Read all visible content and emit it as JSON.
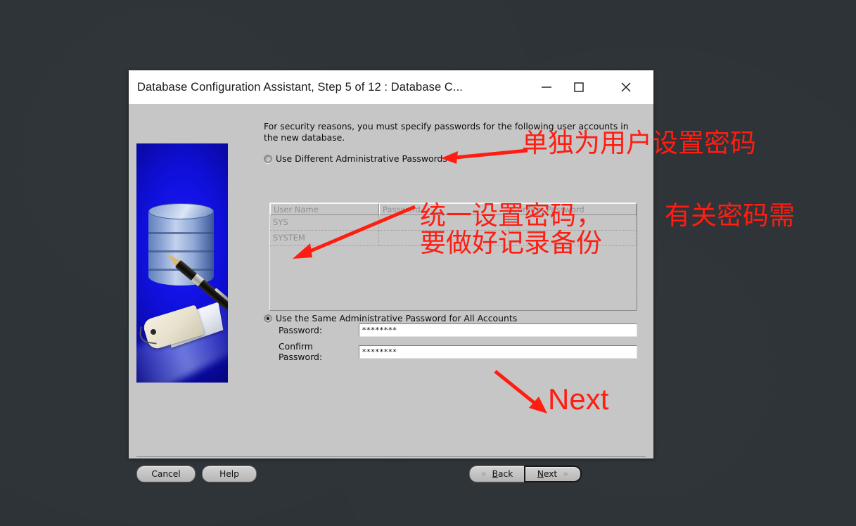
{
  "window": {
    "title": "Database Configuration Assistant, Step 5 of 12 : Database C...",
    "controls": {
      "minimize": "minimize-icon",
      "maximize": "maximize-icon",
      "close": "close-icon"
    }
  },
  "content": {
    "instruction": "For security reasons, you must specify passwords for the following user accounts in the new database.",
    "radio_different": {
      "label": "Use Different Administrative Passwords",
      "selected": false
    },
    "radio_same": {
      "label": "Use the Same Administrative Password for All Accounts",
      "selected": true
    },
    "table": {
      "columns": [
        "User Name",
        "Password",
        "Confirm Password"
      ],
      "rows": [
        {
          "user": "SYS",
          "password": "",
          "confirm": ""
        },
        {
          "user": "SYSTEM",
          "password": "",
          "confirm": ""
        }
      ]
    },
    "password_field": {
      "label": "Password:",
      "value": "********",
      "placeholder": ""
    },
    "confirm_field": {
      "label": "Confirm Password:",
      "value": "********",
      "placeholder": ""
    }
  },
  "buttons": {
    "cancel": "Cancel",
    "help": "Help",
    "back": "Back",
    "back_mnemonic": "B",
    "back_rest": "ack",
    "next": "Next",
    "next_mnemonic": "N",
    "next_rest": "ext",
    "back_chevron": "«",
    "next_chevron": "»"
  },
  "annotations": {
    "color": "#ff1d12",
    "note_different": "单独为用户设置密码",
    "note_same_line1": "统一设置密码，",
    "note_same_line2": "要做好记录备份",
    "note_same_right": "有关密码需",
    "note_next": "Next"
  },
  "banner": {
    "name": "database-pen-tag-illustration"
  }
}
